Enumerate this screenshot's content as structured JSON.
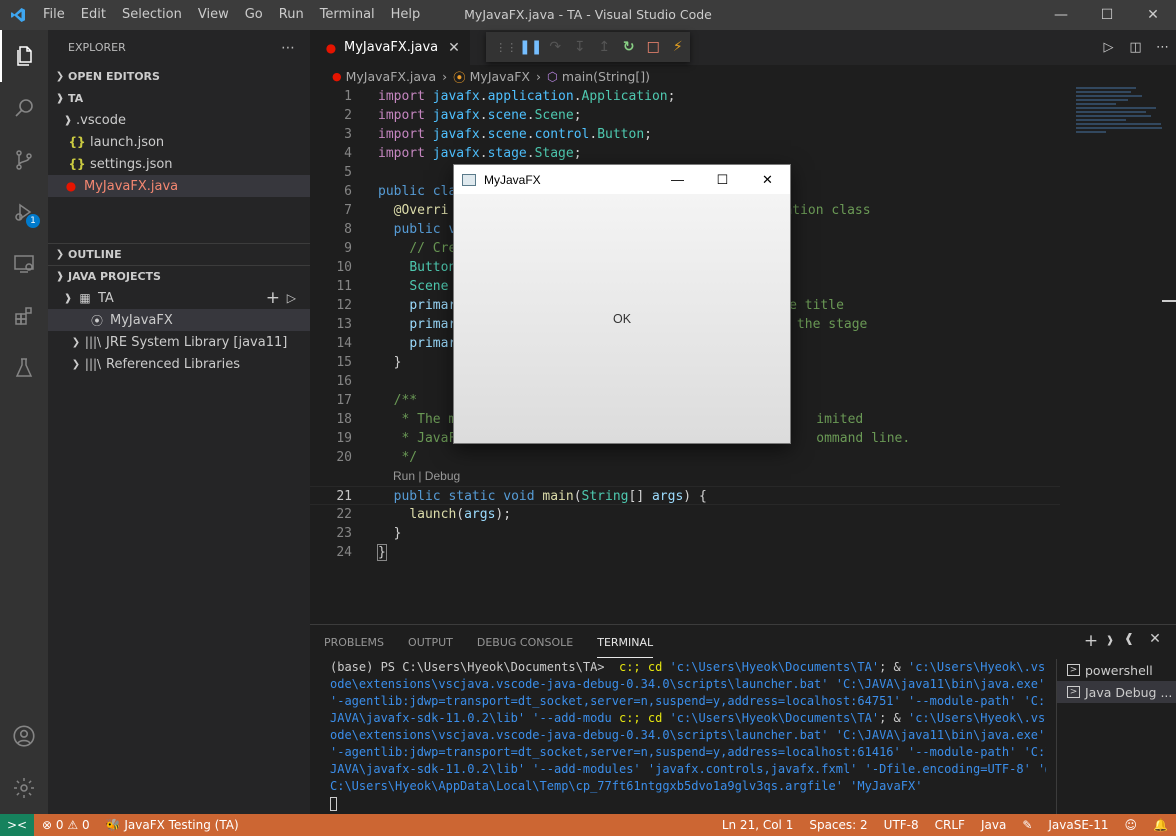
{
  "app": {
    "window_title": "MyJavaFX.java - TA - Visual Studio Code",
    "menu": [
      "File",
      "Edit",
      "Selection",
      "View",
      "Go",
      "Run",
      "Terminal",
      "Help"
    ]
  },
  "activity": {
    "debug_badge": "1"
  },
  "sidebar": {
    "header": "EXPLORER",
    "open_editors": "OPEN EDITORS",
    "workspace": "TA",
    "folder": ".vscode",
    "files": [
      "launch.json",
      "settings.json"
    ],
    "active_file": "MyJavaFX.java",
    "outline": "OUTLINE",
    "java_projects": "JAVA PROJECTS",
    "project": "TA",
    "class_item": "MyJavaFX",
    "jre": "JRE System Library [java11]",
    "ref_libs": "Referenced Libraries"
  },
  "editor": {
    "tab_label": "MyJavaFX.java",
    "breadcrumb": [
      "MyJavaFX.java",
      "MyJavaFX",
      "main(String[])"
    ],
    "codelens": "Run | Debug",
    "line_numbers": [
      "1",
      "2",
      "3",
      "4",
      "5",
      "6",
      "7",
      "8",
      "9",
      "10",
      "11",
      "12",
      "13",
      "14",
      "15",
      "16",
      "17",
      "18",
      "19",
      "20",
      "21",
      "22",
      "23",
      "24"
    ],
    "code": {
      "l1": [
        "import",
        " javafx",
        ".",
        "application",
        ".",
        "Application",
        ";"
      ],
      "l2": [
        "import",
        " javafx",
        ".",
        "scene",
        ".",
        "Scene",
        ";"
      ],
      "l3": [
        "import",
        " javafx",
        ".",
        "scene",
        ".",
        "control",
        ".",
        "Button",
        ";"
      ],
      "l4": [
        "import",
        " javafx",
        ".",
        "stage",
        ".",
        "Stage",
        ";"
      ],
      "l6": [
        "public",
        " cla"
      ],
      "l7": [
        "@Overri",
        "ation class"
      ],
      "l8": [
        "public",
        " v"
      ],
      "l9": "// Cre",
      "l10": "Button",
      "l11": "Scene",
      "l12": [
        "primar",
        "ge title"
      ],
      "l13": [
        "primar",
        "n the stage"
      ],
      "l14": "primar",
      "l15": "}",
      "l17": "/**",
      "l18": [
        "* The m",
        "imited"
      ],
      "l19": [
        "* JavaF",
        "ommand line."
      ],
      "l20": "*/",
      "l21": [
        "public",
        " ",
        "static",
        " ",
        "void",
        " ",
        "main",
        "(",
        "String",
        "[] ",
        "args",
        ") {"
      ],
      "l22": [
        "launch",
        "(",
        "args",
        ");"
      ],
      "l23": "}",
      "l24": "}"
    }
  },
  "panel": {
    "tabs": [
      "PROBLEMS",
      "OUTPUT",
      "DEBUG CONSOLE",
      "TERMINAL"
    ],
    "active_tab": "TERMINAL",
    "terminal_lines": [
      "(base) PS C:\\Users\\Hyeok\\Documents\\TA>  c:; cd 'c:\\Users\\Hyeok\\Documents\\TA'; & 'c:\\Users\\Hyeok\\.vsc",
      "ode\\extensions\\vscjava.vscode-java-debug-0.34.0\\scripts\\launcher.bat' 'C:\\JAVA\\java11\\bin\\java.exe'",
      "'-agentlib:jdwp=transport=dt_socket,server=n,suspend=y,address=localhost:64751' '--module-path' 'C:\\",
      "JAVA\\javafx-sdk-11.0.2\\lib' '--add-modu c:; cd 'c:\\Users\\Hyeok\\Documents\\TA'; & 'c:\\Users\\Hyeok\\.vsc",
      "ode\\extensions\\vscjava.vscode-java-debug-0.34.0\\scripts\\launcher.bat' 'C:\\JAVA\\java11\\bin\\java.exe'",
      "'-agentlib:jdwp=transport=dt_socket,server=n,suspend=y,address=localhost:61416' '--module-path' 'C:\\",
      "JAVA\\javafx-sdk-11.0.2\\lib' '--add-modules' 'javafx.controls,javafx.fxml' '-Dfile.encoding=UTF-8' '@",
      "C:\\Users\\Hyeok\\AppData\\Local\\Temp\\cp_77ft61ntggxb5dvo1a9glv3qs.argfile' 'MyJavaFX'"
    ],
    "terminals": [
      "powershell",
      "Java Debug ..."
    ]
  },
  "status": {
    "errors": "0",
    "warnings": "0",
    "launch_config": "JavaFX Testing (TA)",
    "position": "Ln 21, Col 1",
    "spaces": "Spaces: 2",
    "encoding": "UTF-8",
    "eol": "CRLF",
    "language": "Java",
    "runtime": "JavaSE-11"
  },
  "javafx_window": {
    "title": "MyJavaFX",
    "button_label": "OK"
  },
  "colors": {
    "statusbar": "#cc6633",
    "accent": "#007acc"
  }
}
